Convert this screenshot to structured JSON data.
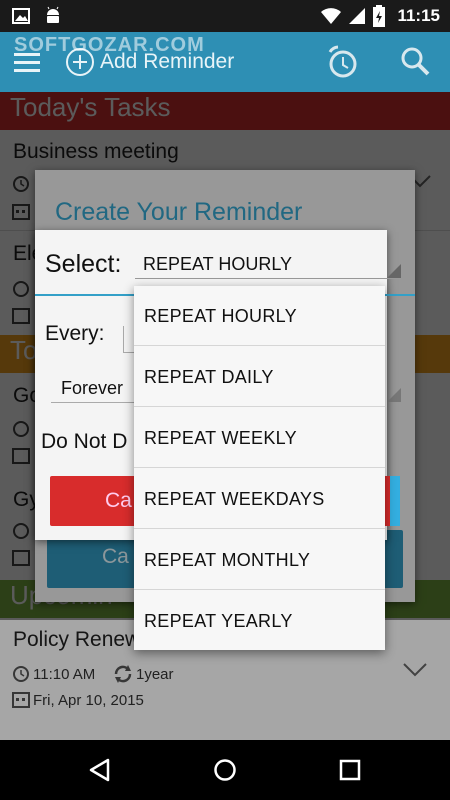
{
  "status_bar": {
    "time": "11:15"
  },
  "app_bar": {
    "title": "Add Reminder"
  },
  "watermark": "SOFTGOZAR.COM",
  "list": {
    "section_today": "Today's Tasks",
    "task1_title": "Business meeting",
    "task2_title_partial": "Ele",
    "section_tomorrow_partial": "To",
    "task3_title_partial": "Go",
    "task4_title_partial": "Gy",
    "section_upcoming_partial": "Upcomin",
    "policy": {
      "title_partial": "Policy Renew",
      "time": "11:10 AM",
      "repeat": "1year",
      "date": "Fri, Apr 10, 2015"
    }
  },
  "dialog_outer": {
    "title": "Create Your Reminder",
    "button_partial": "Ca"
  },
  "dialog_inner": {
    "select_label": "Select:",
    "selected_value": "REPEAT HOURLY",
    "every_label": "Every:",
    "forever_label": "Forever",
    "do_not_disturb_partial": "Do Not D",
    "cancel_partial": "Ca"
  },
  "dropdown_options": [
    "REPEAT HOURLY",
    "REPEAT DAILY",
    "REPEAT WEEKLY",
    "REPEAT WEEKDAYS",
    "REPEAT MONTHLY",
    "REPEAT YEARLY"
  ],
  "colors": {
    "app_bar": "#2e8fb4",
    "today": "#d32f2f",
    "tomorrow": "#f0a020",
    "upcoming": "#7cb342",
    "cancel": "#d82c2c",
    "accent": "#33a0c8"
  },
  "icons": [
    "image-icon",
    "android-icon",
    "wifi-icon",
    "signal-icon",
    "battery-icon",
    "menu-icon",
    "alarm-icon",
    "search-icon",
    "clock-icon",
    "calendar-icon",
    "repeat-icon",
    "chevron-down-icon",
    "back-icon",
    "home-icon",
    "recents-icon"
  ]
}
